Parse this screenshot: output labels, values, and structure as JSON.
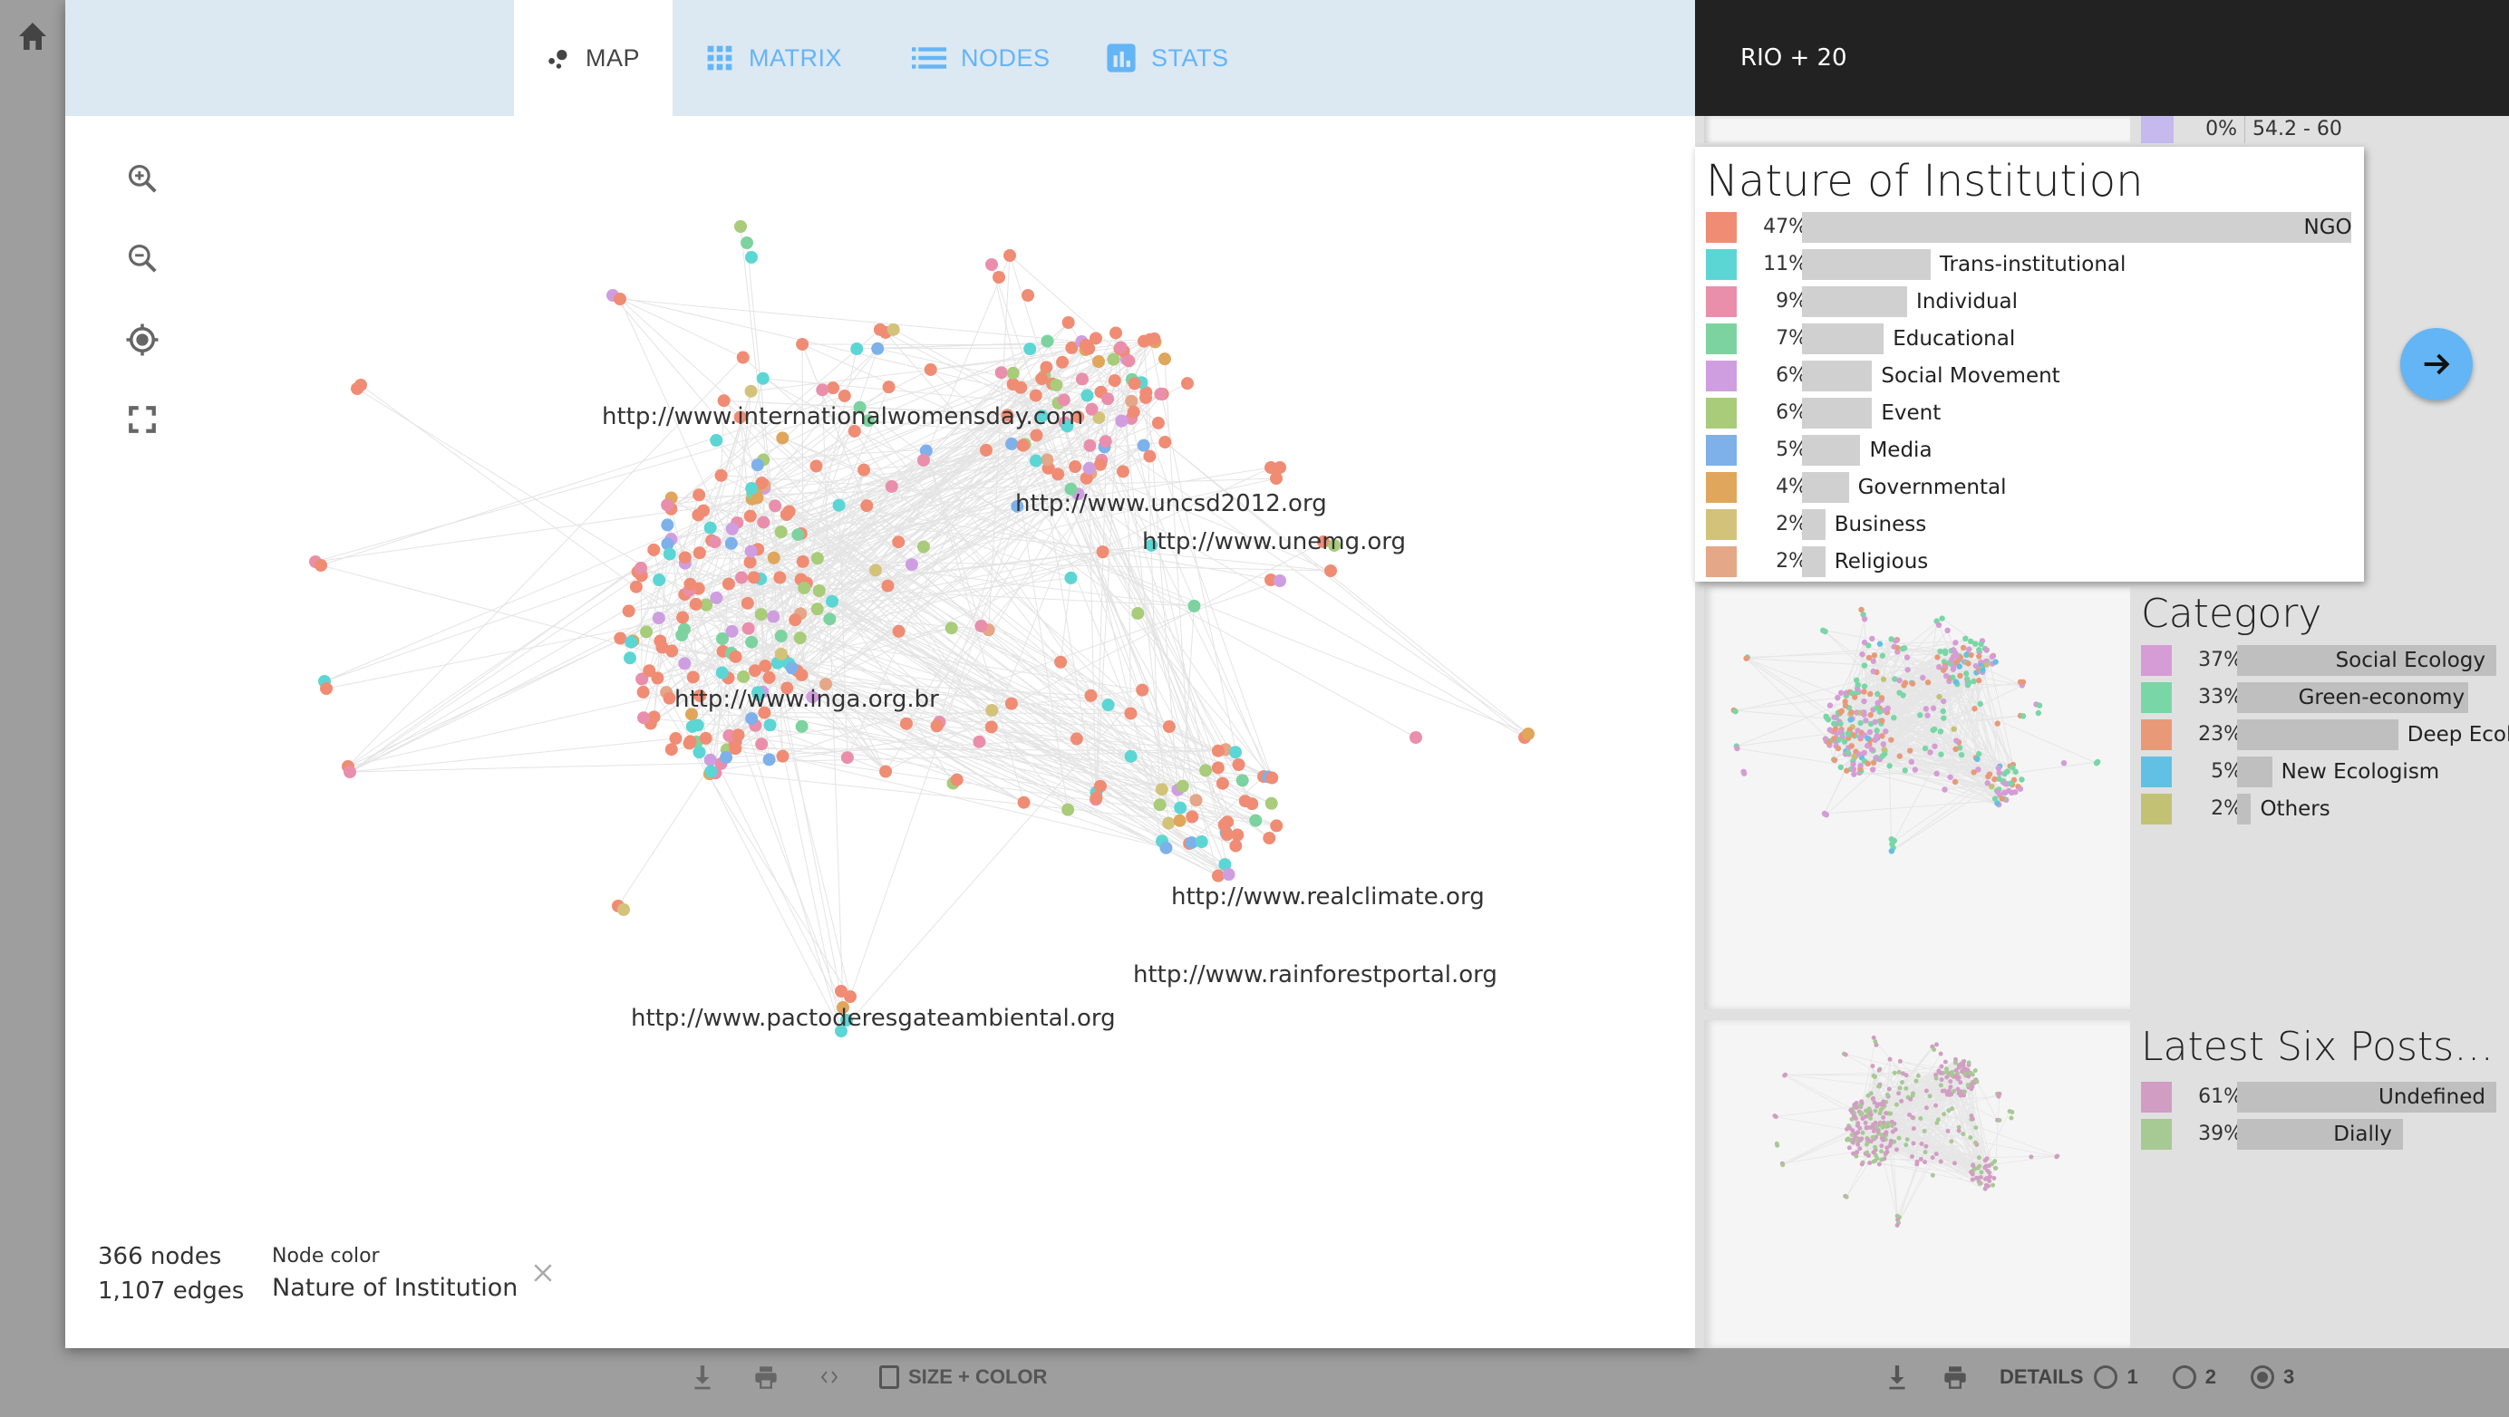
{
  "nav": {
    "home_icon": "home-icon",
    "tabs": [
      {
        "label": "MAP",
        "icon": "map-dots-icon",
        "active": true
      },
      {
        "label": "MATRIX",
        "icon": "grid-icon",
        "active": false
      },
      {
        "label": "NODES",
        "icon": "list-icon",
        "active": false
      },
      {
        "label": "STATS",
        "icon": "bar-chart-icon",
        "active": false
      }
    ]
  },
  "map": {
    "controls": [
      "zoom-in-icon",
      "zoom-out-icon",
      "locate-icon",
      "fullscreen-icon"
    ],
    "node_count": "366 nodes",
    "edge_count": "1,107 edges",
    "node_color_label": "Node color",
    "node_color_value": "Nature of Institution",
    "node_labels": [
      "http://www.internationalwomensday.com",
      "http://www.uncsd2012.org",
      "http://www.unemg.org",
      "http://www.inga.org.br",
      "http://www.realclimate.org",
      "http://www.rainforestportal.org",
      "http://www.pactoderesgateambiental.org"
    ],
    "edge_color": "#e4e4e4"
  },
  "bottom_left": {
    "download_icon": "download-icon",
    "print_icon": "print-icon",
    "embed_icon": "code-icon",
    "size_color_label": "SIZE + COLOR",
    "size_color_checked": false
  },
  "bottom_right": {
    "download_icon": "download-icon",
    "print_icon": "print-icon",
    "details_label": "DETAILS",
    "detail_options": [
      "1",
      "2",
      "3"
    ],
    "detail_selected": "3"
  },
  "sidebar": {
    "title": "RIO + 20",
    "peek_row": {
      "pct": "0%",
      "label": "54.2 - 60",
      "color": "#c5b9ee"
    },
    "next_button_icon": "arrow-right-icon",
    "attributes": [
      {
        "title": "Nature of Institution",
        "items": [
          {
            "pct": 47,
            "label": "NGO",
            "color": "#f08c74"
          },
          {
            "pct": 11,
            "label": "Trans-institutional",
            "color": "#5cd6d4"
          },
          {
            "pct": 9,
            "label": "Individual",
            "color": "#e98fac"
          },
          {
            "pct": 7,
            "label": "Educational",
            "color": "#7dd3a0"
          },
          {
            "pct": 6,
            "label": "Social Movement",
            "color": "#cf9ee0"
          },
          {
            "pct": 6,
            "label": "Event",
            "color": "#a8cc7a"
          },
          {
            "pct": 5,
            "label": "Media",
            "color": "#7eb1ea"
          },
          {
            "pct": 4,
            "label": "Governmental",
            "color": "#dfa65c"
          },
          {
            "pct": 2,
            "label": "Business",
            "color": "#d3c37a"
          },
          {
            "pct": 2,
            "label": "Religious",
            "color": "#e4a787"
          }
        ]
      },
      {
        "title": "Category",
        "items": [
          {
            "pct": 37,
            "label": "Social Ecology",
            "color": "#d59cd6"
          },
          {
            "pct": 33,
            "label": "Green-economy",
            "color": "#79d6a6"
          },
          {
            "pct": 23,
            "label": "Deep Ecology",
            "color": "#e89a78"
          },
          {
            "pct": 5,
            "label": "New Ecologism",
            "color": "#62c0e4"
          },
          {
            "pct": 2,
            "label": "Others",
            "color": "#c3c274"
          }
        ]
      },
      {
        "title": "Latest Six Posts F...",
        "items": [
          {
            "pct": 61,
            "label": "Undefined",
            "color": "#d29dc3"
          },
          {
            "pct": 39,
            "label": "Dially",
            "color": "#a7c993"
          }
        ]
      }
    ]
  }
}
